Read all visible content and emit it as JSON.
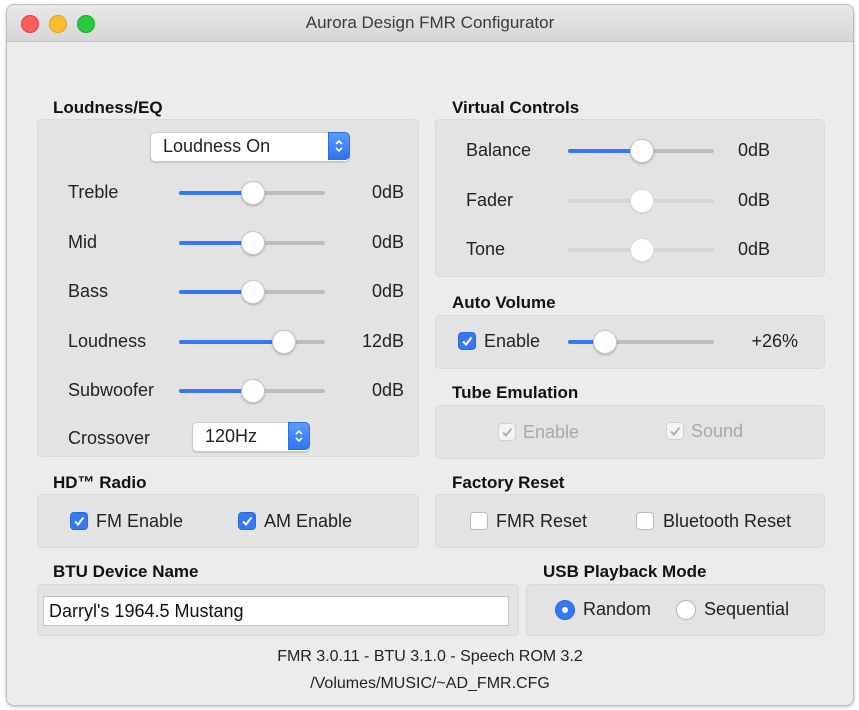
{
  "window": {
    "title": "Aurora Design FMR Configurator"
  },
  "loudness_eq": {
    "title": "Loudness/EQ",
    "mode_popup": "Loudness On",
    "rows": [
      {
        "label": "Treble",
        "value": "0dB",
        "level": 0.5
      },
      {
        "label": "Mid",
        "value": "0dB",
        "level": 0.5
      },
      {
        "label": "Bass",
        "value": "0dB",
        "level": 0.5
      },
      {
        "label": "Loudness",
        "value": "12dB",
        "level": 0.75
      },
      {
        "label": "Subwoofer",
        "value": "0dB",
        "level": 0.5
      }
    ],
    "crossover_label": "Crossover",
    "crossover_value": "120Hz"
  },
  "virtual_controls": {
    "title": "Virtual Controls",
    "rows": [
      {
        "label": "Balance",
        "value": "0dB",
        "level": 0.5,
        "enabled": true
      },
      {
        "label": "Fader",
        "value": "0dB",
        "level": 0.5,
        "enabled": false
      },
      {
        "label": "Tone",
        "value": "0dB",
        "level": 0.5,
        "enabled": false
      }
    ]
  },
  "auto_volume": {
    "title": "Auto Volume",
    "enable_label": "Enable",
    "checked": true,
    "value": "+26%",
    "level": 0.2
  },
  "tube_emulation": {
    "title": "Tube Emulation",
    "enable_label": "Enable",
    "sound_label": "Sound",
    "enable_checked": true,
    "sound_checked": true,
    "enabled": false
  },
  "hd_radio": {
    "title": "HD™ Radio",
    "fm_label": "FM Enable",
    "am_label": "AM Enable",
    "fm_checked": true,
    "am_checked": true
  },
  "factory_reset": {
    "title": "Factory Reset",
    "fmr_label": "FMR Reset",
    "bt_label": "Bluetooth Reset",
    "fmr_checked": false,
    "bt_checked": false
  },
  "btu_device": {
    "title": "BTU Device Name",
    "value": "Darryl's 1964.5 Mustang"
  },
  "usb_playback": {
    "title": "USB Playback Mode",
    "random_label": "Random",
    "sequential_label": "Sequential",
    "selected": "Random"
  },
  "footer": {
    "versions": "FMR 3.0.11  -  BTU 3.1.0  -  Speech ROM 3.2",
    "path": "/Volumes/MUSIC/~AD_FMR.CFG"
  },
  "colors": {
    "accent": "#3478f6",
    "window_bg": "#ececec",
    "group_bg": "#e3e3e3",
    "disabled_text": "#a8a8a8"
  }
}
